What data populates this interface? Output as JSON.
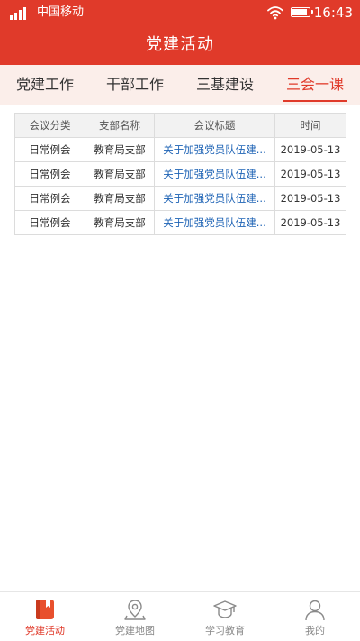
{
  "status_bar": {
    "carrier": "中国移动",
    "time": "16:43"
  },
  "header": {
    "title": "党建活动"
  },
  "tabs": [
    {
      "label": "党建工作",
      "active": false
    },
    {
      "label": "干部工作",
      "active": false
    },
    {
      "label": "三基建设",
      "active": false
    },
    {
      "label": "三会一课",
      "active": true
    }
  ],
  "table": {
    "columns": [
      "会议分类",
      "支部名称",
      "会议标题",
      "时间"
    ],
    "rows": [
      [
        "日常例会",
        "教育局支部",
        "关于加强党员队伍建...",
        "2019-05-13"
      ],
      [
        "日常例会",
        "教育局支部",
        "关于加强党员队伍建...",
        "2019-05-13"
      ],
      [
        "日常例会",
        "教育局支部",
        "关于加强党员队伍建...",
        "2019-05-13"
      ],
      [
        "日常例会",
        "教育局支部",
        "关于加强党员队伍建...",
        "2019-05-13"
      ]
    ]
  },
  "bottom_nav": [
    {
      "label": "党建活动",
      "icon": "bookmark-book-icon",
      "active": true
    },
    {
      "label": "党建地图",
      "icon": "map-pin-icon",
      "active": false
    },
    {
      "label": "学习教育",
      "icon": "graduation-cap-icon",
      "active": false
    },
    {
      "label": "我的",
      "icon": "user-icon",
      "active": false
    }
  ],
  "colors": {
    "brand": "#e03a2a",
    "tab_background": "#fbeeea",
    "link": "#1e63b5"
  }
}
